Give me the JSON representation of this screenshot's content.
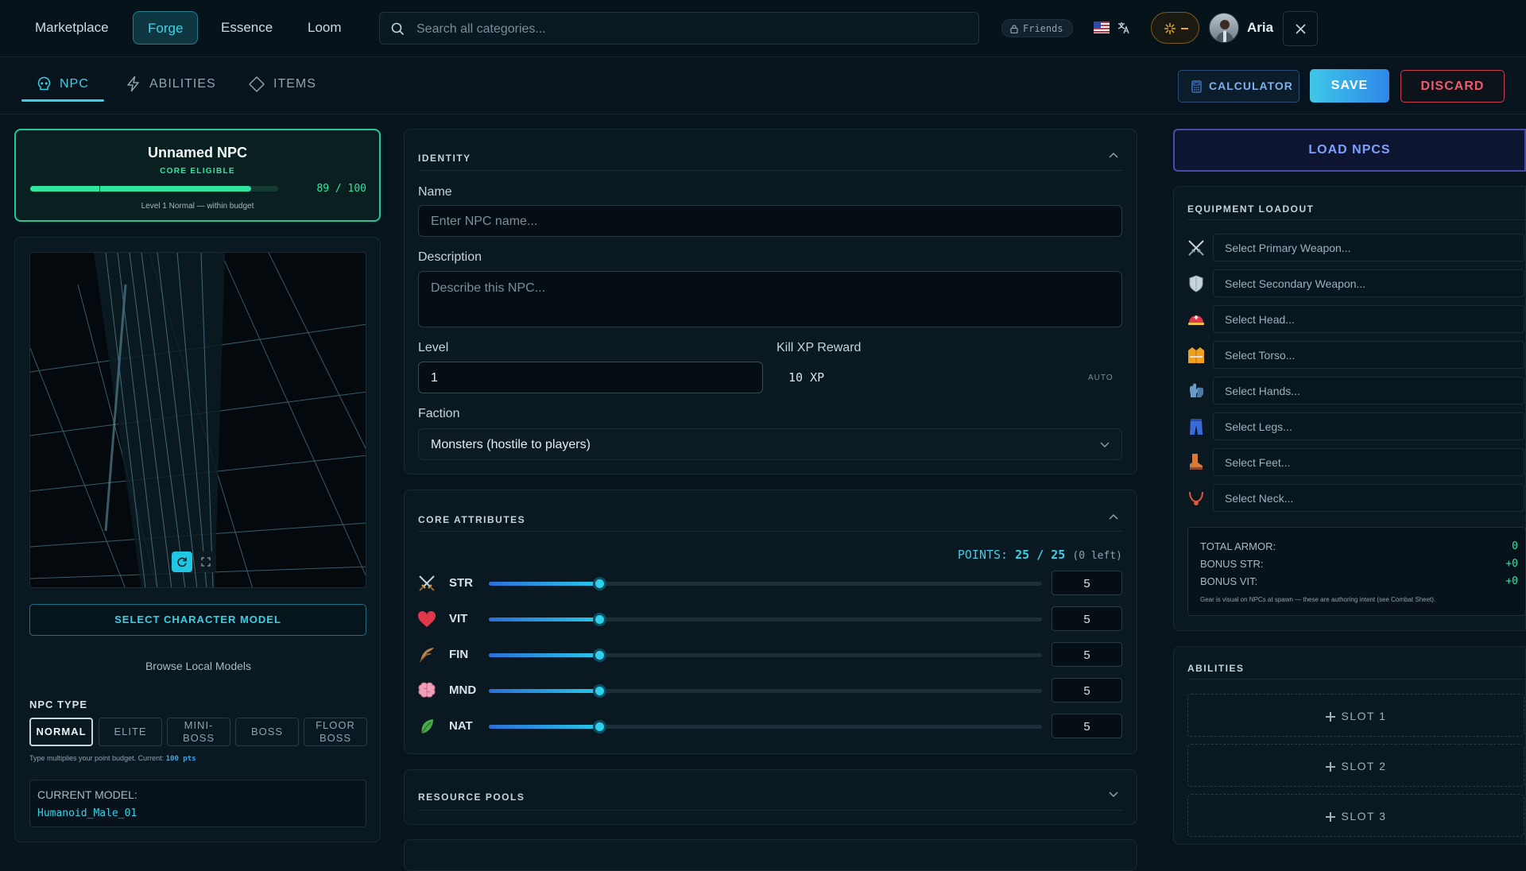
{
  "nav": {
    "items": [
      "Marketplace",
      "Forge",
      "Essence",
      "Loom"
    ]
  },
  "search": {
    "placeholder": "Search all categories..."
  },
  "header": {
    "friends_label": "Friends",
    "user_name": "Aria"
  },
  "tabs": [
    {
      "label": "NPC",
      "icon": "skull-icon"
    },
    {
      "label": "ABILITIES",
      "icon": "lightning-icon"
    },
    {
      "label": "ITEMS",
      "icon": "diamond-icon"
    }
  ],
  "actions": {
    "calculator": "CALCULATOR",
    "save": "SAVE",
    "discard": "DISCARD"
  },
  "summary": {
    "name": "Unnamed NPC",
    "badge": "CORE ELIGIBLE",
    "budget_text": "89 / 100",
    "budget_fraction": 0.89,
    "status": "Level 1 Normal — within budget"
  },
  "model": {
    "select_button": "SELECT CHARACTER MODEL",
    "browse_link": "Browse Local Models",
    "npc_type_title": "NPC TYPE",
    "types": [
      "NORMAL",
      "ELITE",
      "MINI-BOSS",
      "BOSS",
      "FLOOR BOSS"
    ],
    "selected_type": "NORMAL",
    "type_hint": "Type multiplies your point budget. Current:",
    "type_hint_value": "100 pts",
    "current_model_label": "CURRENT MODEL:",
    "current_model_value": "Humanoid_Male_01"
  },
  "identity": {
    "title": "IDENTITY",
    "name_label": "Name",
    "name_placeholder": "Enter NPC name...",
    "description_label": "Description",
    "description_placeholder": "Describe this NPC...",
    "level_label": "Level",
    "level_value": "1",
    "xp_label": "Kill XP Reward",
    "xp_value": "10 XP",
    "xp_auto": "AUTO",
    "faction_label": "Faction",
    "faction_value": "Monsters (hostile to players)"
  },
  "attributes": {
    "title": "CORE ATTRIBUTES",
    "points_label": "POINTS:",
    "points_value": "25 / 25",
    "points_left": "(0 left)",
    "items": [
      {
        "name": "STR",
        "value": "5",
        "level": 0.2,
        "icon": "crossed-swords-icon"
      },
      {
        "name": "VIT",
        "value": "5",
        "level": 0.2,
        "icon": "heart-icon"
      },
      {
        "name": "FIN",
        "value": "5",
        "level": 0.2,
        "icon": "feather-icon"
      },
      {
        "name": "MND",
        "value": "5",
        "level": 0.2,
        "icon": "brain-icon"
      },
      {
        "name": "NAT",
        "value": "5",
        "level": 0.2,
        "icon": "leaf-icon"
      }
    ]
  },
  "resource_pools": {
    "title": "RESOURCE POOLS"
  },
  "load_npcs": "LOAD NPCS",
  "equipment": {
    "title": "EQUIPMENT LOADOUT",
    "slots": [
      {
        "label": "Select Primary Weapon...",
        "icon": "crossed-swords-icon"
      },
      {
        "label": "Select Secondary Weapon...",
        "icon": "shield-icon"
      },
      {
        "label": "Select Head...",
        "icon": "helmet-icon"
      },
      {
        "label": "Select Torso...",
        "icon": "vest-icon"
      },
      {
        "label": "Select Hands...",
        "icon": "gloves-icon"
      },
      {
        "label": "Select Legs...",
        "icon": "pants-icon"
      },
      {
        "label": "Select Feet...",
        "icon": "boot-icon"
      },
      {
        "label": "Select Neck...",
        "icon": "necklace-icon"
      }
    ],
    "stats": [
      {
        "label": "TOTAL ARMOR:",
        "value": "0"
      },
      {
        "label": "BONUS STR:",
        "value": "+0"
      },
      {
        "label": "BONUS VIT:",
        "value": "+0"
      }
    ],
    "note": "Gear is visual on NPCs at spawn — these are authoring intent (see Combat Sheet)."
  },
  "abilities": {
    "title": "ABILITIES",
    "slots": [
      "SLOT 1",
      "SLOT 2",
      "SLOT 3"
    ]
  },
  "colors": {
    "accent": "#38d0e6",
    "success": "#2ee6a0",
    "danger": "#e0485a",
    "background": "#07141d"
  }
}
